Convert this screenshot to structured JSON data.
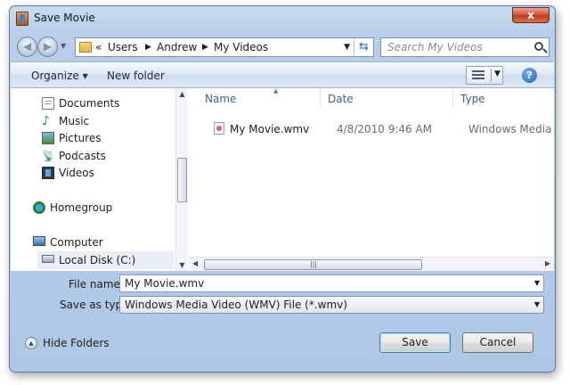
{
  "window": {
    "title": "Save Movie",
    "close_label": "x"
  },
  "nav": {
    "back_glyph": "◀",
    "forward_glyph": "▶"
  },
  "address": {
    "overflow": "«",
    "crumbs": [
      "Users",
      "Andrew",
      "My Videos"
    ]
  },
  "search": {
    "placeholder": "Search My Videos"
  },
  "commands": {
    "organize": "Organize ▾",
    "new_folder": "New folder",
    "help": "?"
  },
  "sidebar": {
    "items": [
      {
        "label": "Documents",
        "icon": "documents-icon"
      },
      {
        "label": "Music",
        "icon": "music-icon"
      },
      {
        "label": "Pictures",
        "icon": "pictures-icon"
      },
      {
        "label": "Podcasts",
        "icon": "podcasts-icon"
      },
      {
        "label": "Videos",
        "icon": "videos-icon"
      },
      {
        "label": "Homegroup",
        "icon": "homegroup-icon"
      },
      {
        "label": "Computer",
        "icon": "computer-icon"
      },
      {
        "label": "Local Disk (C:)",
        "icon": "disk-icon"
      }
    ]
  },
  "columns": [
    "Name",
    "Date",
    "Type"
  ],
  "files": [
    {
      "name": "My Movie.wmv",
      "date": "4/8/2010 9:46 AM",
      "type": "Windows Media A..."
    }
  ],
  "form": {
    "filename_label": "File name:",
    "filename_value": "My Movie.wmv",
    "savetype_label": "Save as type:",
    "savetype_value": "Windows Media Video (WMV) File (*.wmv)"
  },
  "footer": {
    "hide_folders": "Hide Folders",
    "save": "Save",
    "cancel": "Cancel"
  }
}
